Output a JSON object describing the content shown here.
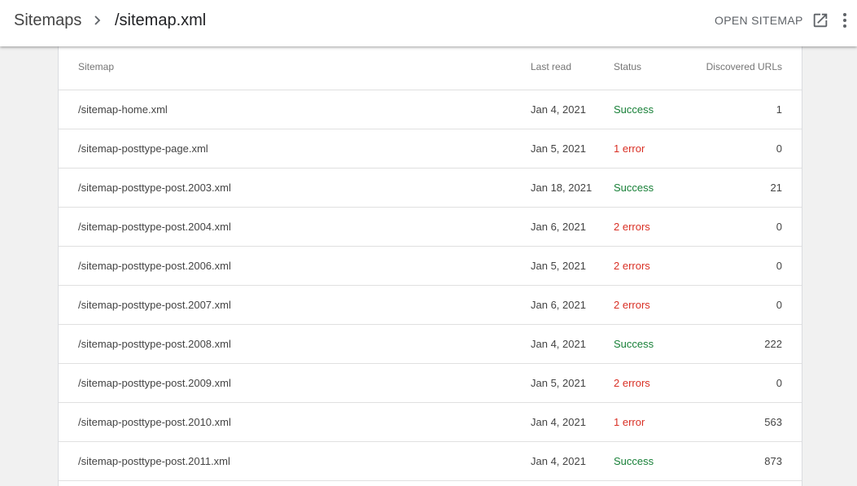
{
  "breadcrumb": {
    "root": "Sitemaps",
    "current": "/sitemap.xml"
  },
  "actions": {
    "open_sitemap": "OPEN SITEMAP",
    "open_icon": "open-in-new-icon",
    "more_icon": "more-vert-icon"
  },
  "table": {
    "columns": {
      "sitemap": "Sitemap",
      "last_read": "Last read",
      "status": "Status",
      "discovered_urls": "Discovered URLs"
    },
    "rows": [
      {
        "sitemap": "/sitemap-home.xml",
        "last_read": "Jan 4, 2021",
        "status": "Success",
        "kind": "ok",
        "urls": "1"
      },
      {
        "sitemap": "/sitemap-posttype-page.xml",
        "last_read": "Jan 5, 2021",
        "status": "1 error",
        "kind": "err",
        "urls": "0"
      },
      {
        "sitemap": "/sitemap-posttype-post.2003.xml",
        "last_read": "Jan 18, 2021",
        "status": "Success",
        "kind": "ok",
        "urls": "21"
      },
      {
        "sitemap": "/sitemap-posttype-post.2004.xml",
        "last_read": "Jan 6, 2021",
        "status": "2 errors",
        "kind": "err",
        "urls": "0"
      },
      {
        "sitemap": "/sitemap-posttype-post.2006.xml",
        "last_read": "Jan 5, 2021",
        "status": "2 errors",
        "kind": "err",
        "urls": "0"
      },
      {
        "sitemap": "/sitemap-posttype-post.2007.xml",
        "last_read": "Jan 6, 2021",
        "status": "2 errors",
        "kind": "err",
        "urls": "0"
      },
      {
        "sitemap": "/sitemap-posttype-post.2008.xml",
        "last_read": "Jan 4, 2021",
        "status": "Success",
        "kind": "ok",
        "urls": "222"
      },
      {
        "sitemap": "/sitemap-posttype-post.2009.xml",
        "last_read": "Jan 5, 2021",
        "status": "2 errors",
        "kind": "err",
        "urls": "0"
      },
      {
        "sitemap": "/sitemap-posttype-post.2010.xml",
        "last_read": "Jan 4, 2021",
        "status": "1 error",
        "kind": "err",
        "urls": "563"
      },
      {
        "sitemap": "/sitemap-posttype-post.2011.xml",
        "last_read": "Jan 4, 2021",
        "status": "Success",
        "kind": "ok",
        "urls": "873"
      }
    ]
  },
  "colors": {
    "success": "#188038",
    "error": "#d93025"
  }
}
